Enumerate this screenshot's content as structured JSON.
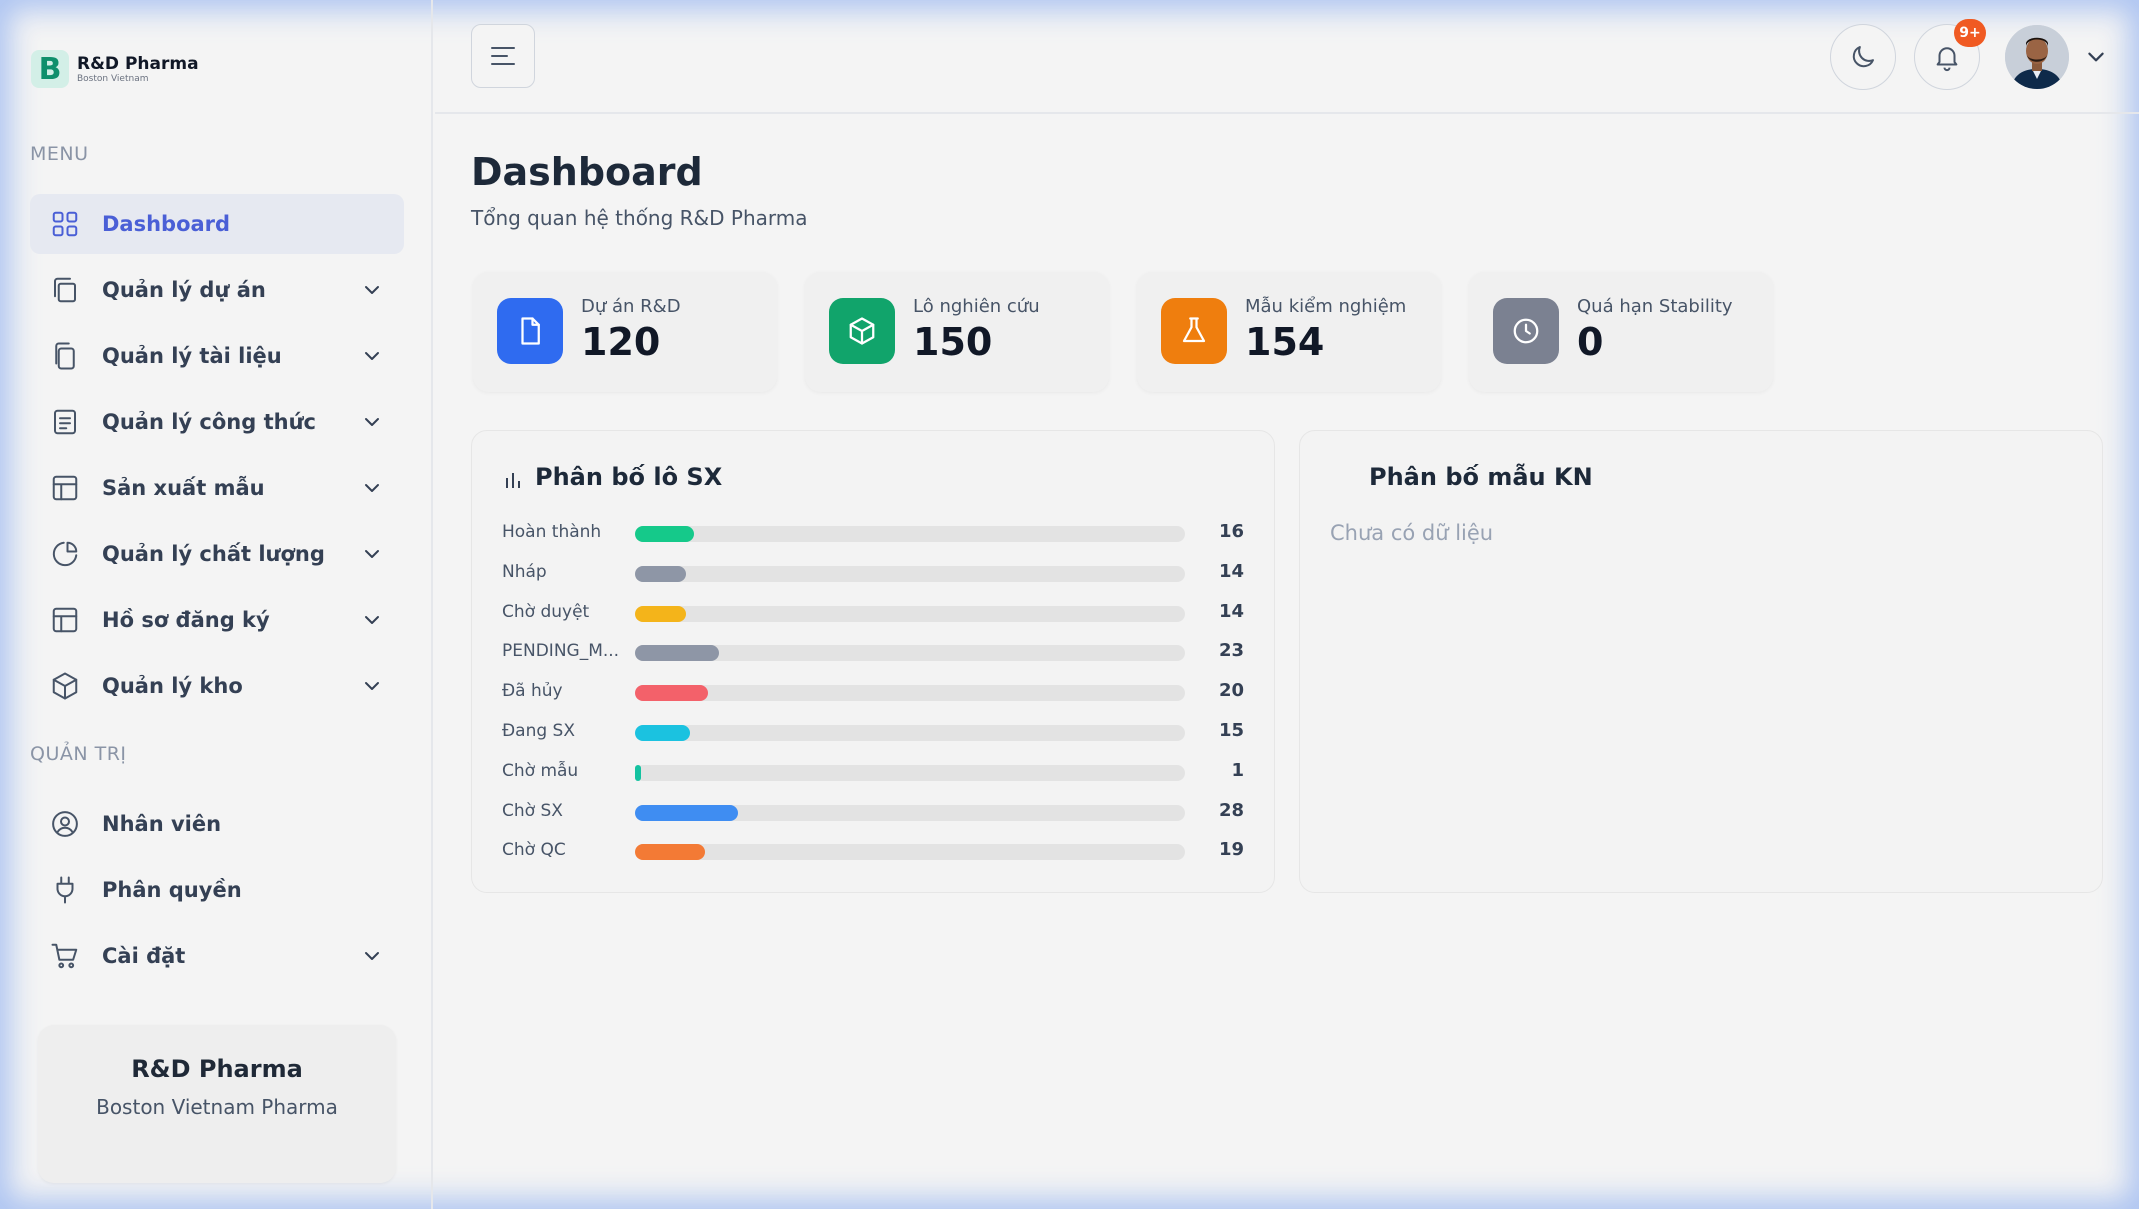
{
  "brand": {
    "title": "R&D Pharma",
    "subtitle": "Boston Vietnam",
    "mark": "B"
  },
  "sidebar": {
    "menu_label": "MENU",
    "admin_label": "QUẢN TRỊ",
    "items": [
      {
        "label": "Dashboard",
        "icon": "grid-icon",
        "active": true,
        "expandable": false
      },
      {
        "label": "Quản lý dự án",
        "icon": "layers-icon",
        "expandable": true
      },
      {
        "label": "Quản lý tài liệu",
        "icon": "copy-icon",
        "expandable": true
      },
      {
        "label": "Quản lý công thức",
        "icon": "document-lines-icon",
        "expandable": true
      },
      {
        "label": "Sản xuất mẫu",
        "icon": "table-icon",
        "expandable": true
      },
      {
        "label": "Quản lý chất lượng",
        "icon": "pie-chart-icon",
        "expandable": true
      },
      {
        "label": "Hồ sơ đăng ký",
        "icon": "layout-icon",
        "expandable": true
      },
      {
        "label": "Quản lý kho",
        "icon": "box-icon",
        "expandable": true
      }
    ],
    "admin_items": [
      {
        "label": "Nhân viên",
        "icon": "user-circle-icon",
        "expandable": false
      },
      {
        "label": "Phân quyền",
        "icon": "plug-icon",
        "expandable": false
      },
      {
        "label": "Cài đặt",
        "icon": "cart-icon",
        "expandable": true
      }
    ],
    "footer_card": {
      "title": "R&D Pharma",
      "subtitle": "Boston Vietnam Pharma"
    }
  },
  "header": {
    "notification_badge": "9+"
  },
  "page": {
    "title": "Dashboard",
    "subtitle": "Tổng quan hệ thống R&D Pharma"
  },
  "stats": [
    {
      "label": "Dự án R&D",
      "value": "120",
      "icon": "file-icon",
      "color": "#2f6bf0"
    },
    {
      "label": "Lô nghiên cứu",
      "value": "150",
      "icon": "cube-icon",
      "color": "#11a46b"
    },
    {
      "label": "Mẫu kiểm nghiệm",
      "value": "154",
      "icon": "flask-icon",
      "color": "#ef7e0e"
    },
    {
      "label": "Quá hạn Stability",
      "value": "0",
      "icon": "clock-icon",
      "color": "#7b8191"
    }
  ],
  "panels": {
    "batch": {
      "title": "Phân bố lô SX"
    },
    "sample": {
      "title": "Phân bố mẫu KN",
      "empty": "Chưa có dữ liệu"
    }
  },
  "chart_data": {
    "type": "bar",
    "orientation": "horizontal",
    "title": "Phân bố lô SX",
    "categories": [
      "Hoàn thành",
      "Nháp",
      "Chờ duyệt",
      "PENDING_M...",
      "Đã hủy",
      "Đang SX",
      "Chờ mẫu",
      "Chờ SX",
      "Chờ QC"
    ],
    "values": [
      16,
      14,
      14,
      23,
      20,
      15,
      1,
      28,
      19
    ],
    "colors": [
      "#15c98a",
      "#8e96a6",
      "#f4b41a",
      "#8e96a6",
      "#f3616a",
      "#1bc2e0",
      "#14c2a0",
      "#3f8df2",
      "#f37a35"
    ],
    "xlim": [
      0,
      150
    ]
  }
}
